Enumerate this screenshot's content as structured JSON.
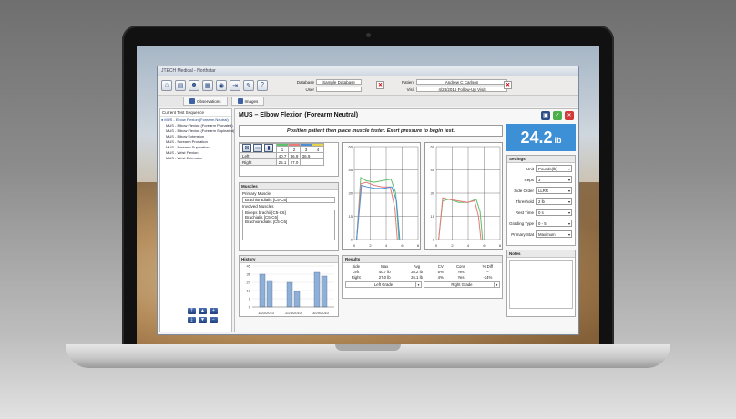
{
  "app": {
    "title": "JTECH Medical - Northstar",
    "toolbar": {
      "database_label": "Database",
      "database_value": "Sample Database",
      "user_label": "User",
      "user_value": "",
      "patient_label": "Patient",
      "patient_value": "Andrew C Carlson",
      "visit_label": "Visit",
      "visit_value": "4/28/2016 Follow-Up Visit"
    },
    "tabs": {
      "observations": "Observations",
      "images": "Images"
    },
    "sequence": {
      "title": "Current Test Sequence",
      "items": [
        "MUS - Elbow Flexion (Forearm Neutral)",
        "MUS - Elbow Flexion (Forearm Pronated)",
        "MUS - Elbow Flexion (Forearm Supinated)",
        "MUS - Elbow Extension",
        "MUS - Forearm Pronation",
        "MUS - Forearm Supination",
        "MUS - Wrist Flexion",
        "MUS - Wrist Extension"
      ]
    },
    "test": {
      "title": "MUS – Elbow Flexion (Forearm Neutral)",
      "instruction": "Position patient then place muscle tester. Exert pressure to begin test.",
      "reading_value": "24.2",
      "reading_unit": "lb"
    },
    "reps": {
      "columns": [
        "1",
        "2",
        "3",
        "4"
      ],
      "column_colors": [
        "#5fbf6a",
        "#e87a7a",
        "#4a8fd6",
        "#e8d24a"
      ],
      "left_label": "Left",
      "left": [
        "40.7",
        "36.9",
        "36.9",
        ""
      ],
      "right_label": "Right",
      "right": [
        "25.1",
        "27.0",
        "",
        ""
      ]
    },
    "muscles": {
      "title": "Muscles",
      "primary_label": "Primary Muscle",
      "primary_value": "Brachioradialis [C5-C6]",
      "involved_label": "Involved Muscles",
      "involved": [
        "Biceps brachii [C5-C6]",
        "Brachialis [C5-C6]",
        "Brachioradialis [C5-C6]"
      ]
    },
    "history": {
      "title": "History",
      "yticks": [
        "45",
        "36",
        "27",
        "18",
        "9",
        "0"
      ],
      "dates": [
        "1/20/2010",
        "2/23/2010",
        "3/29/2010"
      ]
    },
    "results": {
      "title": "Results",
      "headers": [
        "Side",
        "Max",
        "Avg",
        "CV",
        "Cons",
        "% Diff"
      ],
      "rows": [
        [
          "Left",
          "40.7 lb",
          "38.2 lb",
          "5%",
          "Yes",
          "–"
        ],
        [
          "Right",
          "27.0 lb",
          "26.1 lb",
          "4%",
          "Yes",
          "-34%"
        ]
      ],
      "left_grade": "Left Grade",
      "right_grade": "Right Grade"
    },
    "settings": {
      "title": "Settings",
      "rows": [
        {
          "label": "Unit",
          "value": "Pounds(lb)"
        },
        {
          "label": "Reps",
          "value": "3"
        },
        {
          "label": "Side Order",
          "value": "LLRR"
        },
        {
          "label": "Threshold",
          "value": "2 lb"
        },
        {
          "label": "Rest Time",
          "value": "0 s"
        },
        {
          "label": "Grading Type",
          "value": "0 - 5"
        },
        {
          "label": "Primary Stat",
          "value": "Maximum"
        }
      ]
    },
    "notes": {
      "title": "Notes"
    },
    "curve_chart": {
      "yticks": [
        "60",
        "45",
        "30",
        "15",
        "0"
      ],
      "xticks": [
        "0",
        "2",
        "4",
        "6",
        "8"
      ]
    }
  },
  "chart_data": [
    {
      "type": "line",
      "title": "",
      "xlabel": "",
      "ylabel": "",
      "xlim": [
        0,
        8
      ],
      "ylim": [
        0,
        60
      ],
      "series": [
        {
          "color": "#5fbf6a",
          "x": [
            0.3,
            0.8,
            1.5,
            2.5,
            3.5,
            4.6,
            5.2,
            5.6
          ],
          "y": [
            0,
            40,
            38,
            37,
            38,
            39,
            30,
            0
          ]
        },
        {
          "color": "#e87a7a",
          "x": [
            0.3,
            0.8,
            1.5,
            2.5,
            3.5,
            4.5,
            5.1,
            5.4
          ],
          "y": [
            0,
            36,
            37,
            35,
            34,
            34,
            20,
            0
          ]
        },
        {
          "color": "#4a8fd6",
          "x": [
            0.3,
            0.9,
            1.6,
            2.6,
            3.6,
            4.7,
            5.3,
            5.7
          ],
          "y": [
            0,
            35,
            34,
            33,
            33,
            34,
            25,
            0
          ]
        }
      ]
    },
    {
      "type": "line",
      "title": "",
      "xlabel": "",
      "ylabel": "",
      "xlim": [
        0,
        8
      ],
      "ylim": [
        0,
        60
      ],
      "series": [
        {
          "color": "#5fbf6a",
          "x": [
            0.3,
            0.8,
            1.6,
            2.8,
            4.0,
            5.0,
            5.5,
            5.8
          ],
          "y": [
            0,
            25,
            26,
            24,
            24,
            26,
            18,
            0
          ]
        },
        {
          "color": "#e87a7a",
          "x": [
            0.3,
            0.8,
            1.5,
            2.7,
            3.9,
            4.8,
            5.3,
            5.6
          ],
          "y": [
            0,
            27,
            26,
            25,
            24,
            25,
            15,
            0
          ]
        }
      ]
    },
    {
      "type": "bar",
      "title": "History",
      "categories": [
        "1/20/2010",
        "2/23/2010",
        "3/29/2010"
      ],
      "ylim": [
        0,
        45
      ],
      "series": [
        {
          "name": "Left",
          "color": "#8fb0d6",
          "values": [
            36,
            27,
            38
          ]
        },
        {
          "name": "Right",
          "color": "#8fb0d6",
          "values": [
            29,
            17,
            34
          ]
        }
      ]
    }
  ]
}
